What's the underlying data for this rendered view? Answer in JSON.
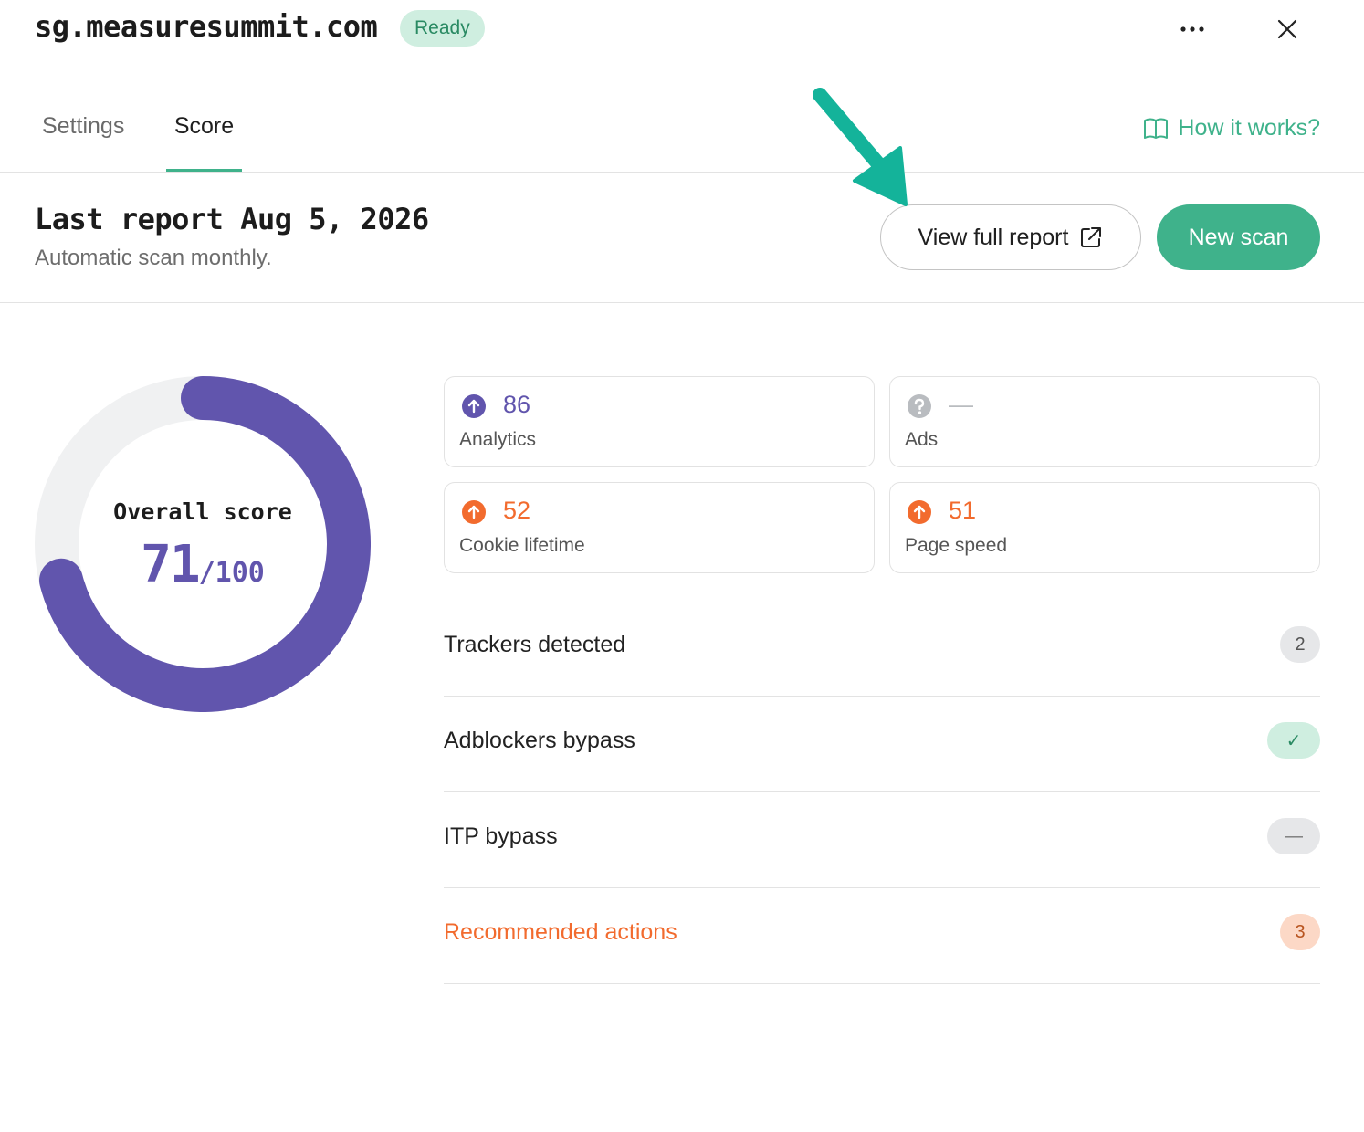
{
  "header": {
    "domain": "sg.measuresummit.com",
    "status": "Ready",
    "more_icon": "more-horizontal-icon",
    "close_icon": "close-icon"
  },
  "tabs": [
    {
      "label": "Settings",
      "active": false
    },
    {
      "label": "Score",
      "active": true
    }
  ],
  "help_link": {
    "label": "How it works?",
    "icon": "book-icon"
  },
  "report": {
    "title": "Last report Aug 5, 2026",
    "subtitle": "Automatic scan monthly.",
    "view_button": "View full report",
    "view_icon": "external-link-icon",
    "new_button": "New scan"
  },
  "overall": {
    "label": "Overall score",
    "score": "71",
    "max": "/100",
    "fraction": 0.71
  },
  "cards": [
    {
      "value": "86",
      "label": "Analytics",
      "icon": "arrow-up-circle-icon",
      "color": "#6155ad"
    },
    {
      "value": "—",
      "label": "Ads",
      "icon": "question-circle-icon",
      "color": "#b9bcc0"
    },
    {
      "value": "52",
      "label": "Cookie lifetime",
      "icon": "arrow-up-circle-icon",
      "color": "#f26b2e"
    },
    {
      "value": "51",
      "label": "Page speed",
      "icon": "arrow-up-circle-icon",
      "color": "#f26b2e"
    }
  ],
  "rows": [
    {
      "label": "Trackers detected",
      "badge": "2"
    },
    {
      "label": "Adblockers bypass",
      "badge": "✓"
    },
    {
      "label": "ITP bypass",
      "badge": "—"
    },
    {
      "label": "Recommended actions",
      "badge": "3"
    }
  ],
  "colors": {
    "accent_green": "#3fb28b",
    "purple": "#6155ad",
    "orange": "#f26b2e",
    "annotation_arrow": "#14b39a"
  }
}
